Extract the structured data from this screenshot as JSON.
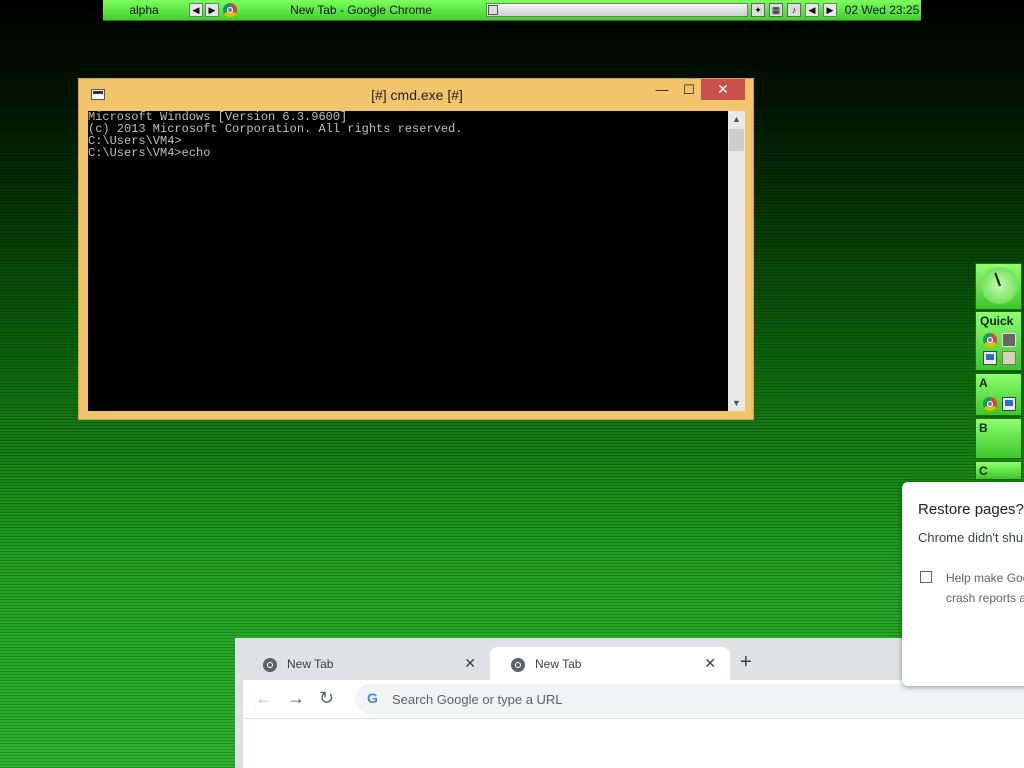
{
  "taskbar": {
    "workspace": "alpha",
    "window_title": "New Tab - Google Chrome",
    "clock": "02 Wed 23:25",
    "left_arrow": "◀",
    "right_arrow": "▶"
  },
  "cmd": {
    "title": "[#] cmd.exe [#]",
    "min_label": "—",
    "max_label": "☐",
    "close_label": "✕",
    "lines": [
      "Microsoft Windows [Version 6.3.9600]",
      "(c) 2013 Microsoft Corporation. All rights reserved.",
      "C:\\Users\\VM4>",
      "C:\\Users\\VM4>echo"
    ]
  },
  "dock": {
    "quick_label": "Quick",
    "a_label": "A",
    "b_label": "B",
    "c_label": "C"
  },
  "restore_dialog": {
    "title": "Restore pages?",
    "body": "Chrome didn't shu",
    "checkbox_line1": "Help make Goo",
    "checkbox_line2": "crash reports a"
  },
  "chrome": {
    "tabs": [
      {
        "label": "New Tab",
        "active": false
      },
      {
        "label": "New Tab",
        "active": true
      }
    ],
    "new_tab_label": "+",
    "omnibox_placeholder": "Search Google or type a URL",
    "omnibox_icon": "G"
  },
  "colors": {
    "taskbar_green": "#5ce63f",
    "cmd_frame": "#f2c56b",
    "close_red": "#c7504b"
  }
}
